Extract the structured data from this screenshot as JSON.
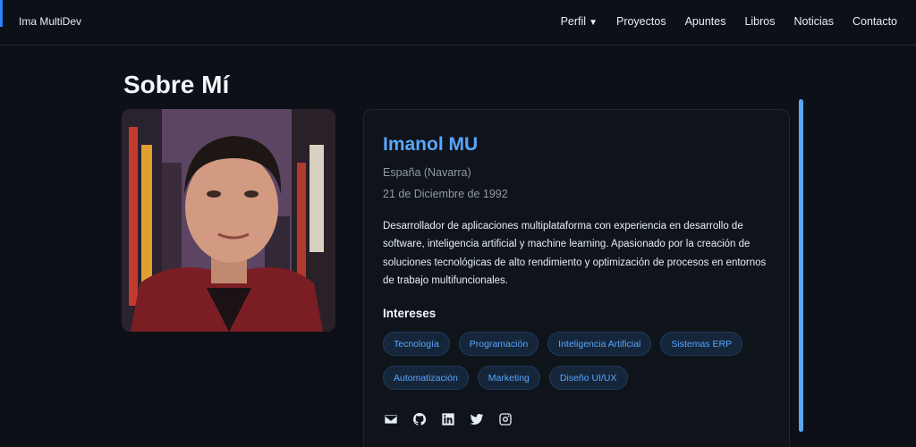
{
  "nav": {
    "brand": "Ima MultiDev",
    "links": [
      {
        "label": "Perfil",
        "caret": "▼"
      },
      {
        "label": "Proyectos"
      },
      {
        "label": "Apuntes"
      },
      {
        "label": "Libros"
      },
      {
        "label": "Noticias"
      },
      {
        "label": "Contacto"
      }
    ]
  },
  "page": {
    "title": "Sobre Mí"
  },
  "profile": {
    "name": "Imanol MU",
    "location": "España (Navarra)",
    "birthdate": "21 de Diciembre de 1992",
    "bio": "Desarrollador de aplicaciones multiplataforma con experiencia en desarrollo de software, inteligencia artificial y machine learning. Apasionado por la creación de soluciones tecnológicas de alto rendimiento y optimización de procesos en entornos de trabajo multifuncionales.",
    "interests_title": "Intereses",
    "interests": [
      "Tecnología",
      "Programación",
      "Inteligencia Artificial",
      "Sistemas ERP",
      "Automatización",
      "Marketing",
      "Diseño UI/UX"
    ],
    "socials": [
      {
        "icon": "email-icon"
      },
      {
        "icon": "github-icon"
      },
      {
        "icon": "linkedin-icon"
      },
      {
        "icon": "twitter-icon"
      },
      {
        "icon": "instagram-icon"
      }
    ]
  },
  "colors": {
    "background": "#0d1117",
    "accent": "#58a6ff",
    "tag_bg": "#16263a"
  }
}
